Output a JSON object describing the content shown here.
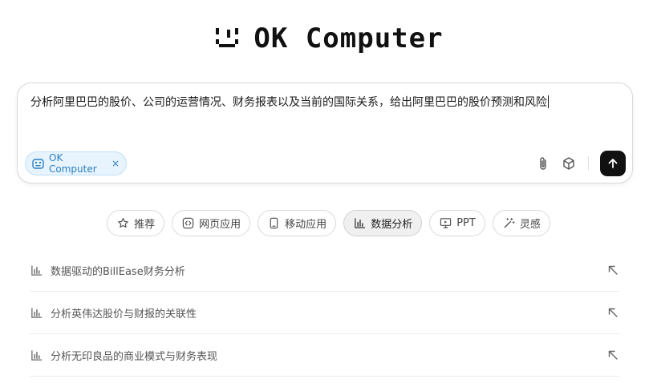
{
  "logo": {
    "text": "OK Computer"
  },
  "input": {
    "query": "分析阿里巴巴的股价、公司的运营情况、财务报表以及当前的国际关系，给出阿里巴巴的股价预测和风险",
    "chip_label": "OK Computer",
    "chip_close": "×"
  },
  "categories": [
    {
      "label": "推荐",
      "icon": "star-icon",
      "active": false
    },
    {
      "label": "网页应用",
      "icon": "code-icon",
      "active": false
    },
    {
      "label": "移动应用",
      "icon": "mobile-icon",
      "active": false
    },
    {
      "label": "数据分析",
      "icon": "bar-chart-icon",
      "active": true
    },
    {
      "label": "PPT",
      "icon": "presentation-icon",
      "active": false
    },
    {
      "label": "灵感",
      "icon": "magic-wand-icon",
      "active": false
    }
  ],
  "suggestions": [
    {
      "text": "数据驱动的BillEase财务分析"
    },
    {
      "text": "分析英伟达股价与财报的关联性"
    },
    {
      "text": "分析无印良品的商业模式与财务表现"
    }
  ],
  "colors": {
    "chip_bg": "#e8f4fd",
    "chip_border": "#bfe0f7",
    "chip_text": "#2b7fc2",
    "send_button": "#111111",
    "active_pill_bg": "#f0f0f0"
  }
}
